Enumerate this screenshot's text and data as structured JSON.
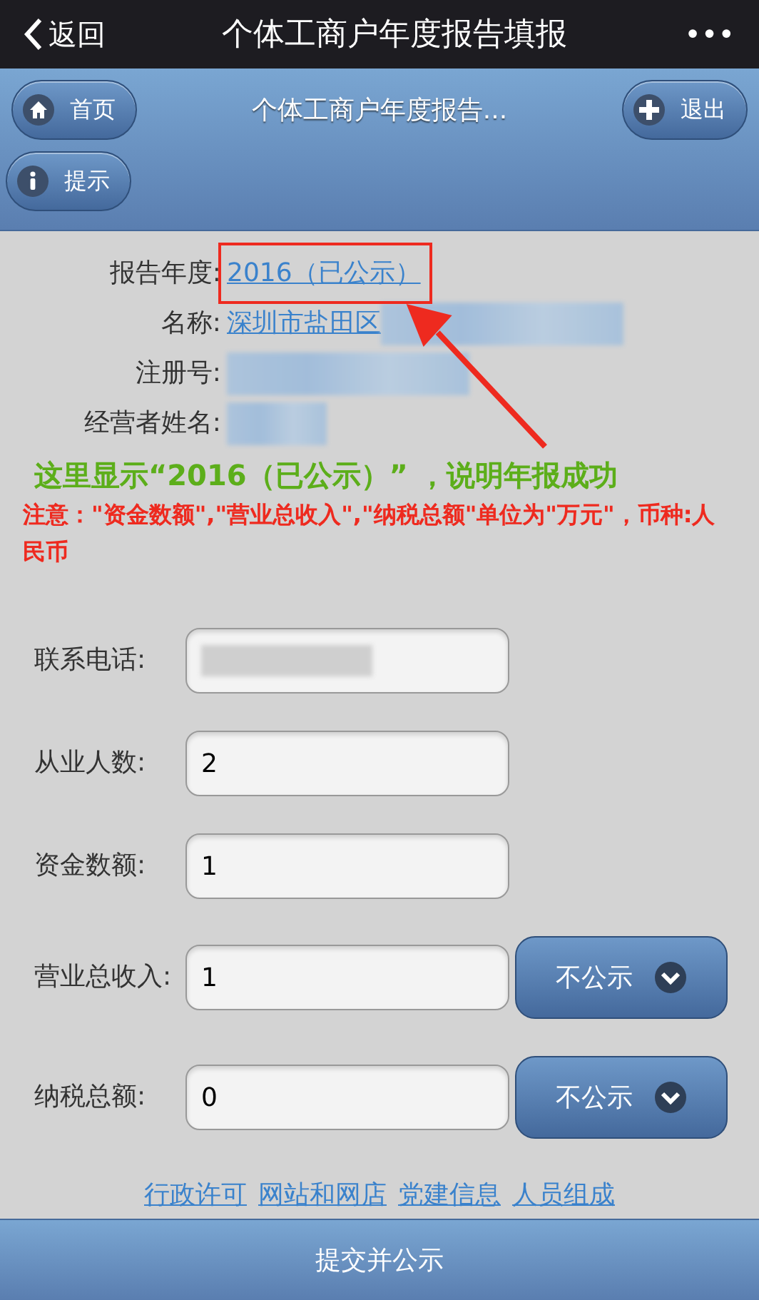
{
  "top_bar": {
    "back": "返回",
    "title": "个体工商户年度报告填报",
    "more": "•••"
  },
  "header": {
    "title": "个体工商户年度报告...",
    "home_button": "首页",
    "exit_button": "退出",
    "hint_button": "提示"
  },
  "info": [
    {
      "label": "报告年度:",
      "value": "2016（已公示）",
      "redacted": false,
      "highlighted": true
    },
    {
      "label": "名称:",
      "value": "深圳市盐田区",
      "redacted": true,
      "highlighted": false
    },
    {
      "label": "注册号:",
      "redacted": true,
      "highlighted": false
    },
    {
      "label": "经营者姓名:",
      "redacted": true,
      "highlighted": false
    }
  ],
  "annotation": {
    "caption": "这里显示“2016（已公示）” ，说明年报成功"
  },
  "notice": "注意：\"资金数额\",\"营业总收入\",\"纳税总额\"单位为\"万元\"，币种:人民币",
  "fields": [
    {
      "label": "联系电话:",
      "redacted": true
    },
    {
      "label": "从业人数:",
      "value": "2",
      "redacted": false
    },
    {
      "label": "资金数额:",
      "value": "1",
      "redacted": false
    },
    {
      "label": "营业总收入:",
      "value": "1",
      "redacted": false,
      "toggle": "不公示"
    },
    {
      "label": "纳税总额:",
      "value": "0",
      "redacted": false,
      "toggle": "不公示"
    }
  ],
  "links": [
    "行政许可",
    "网站和网店",
    "党建信息",
    "人员组成"
  ],
  "submit": "提交并公示"
}
